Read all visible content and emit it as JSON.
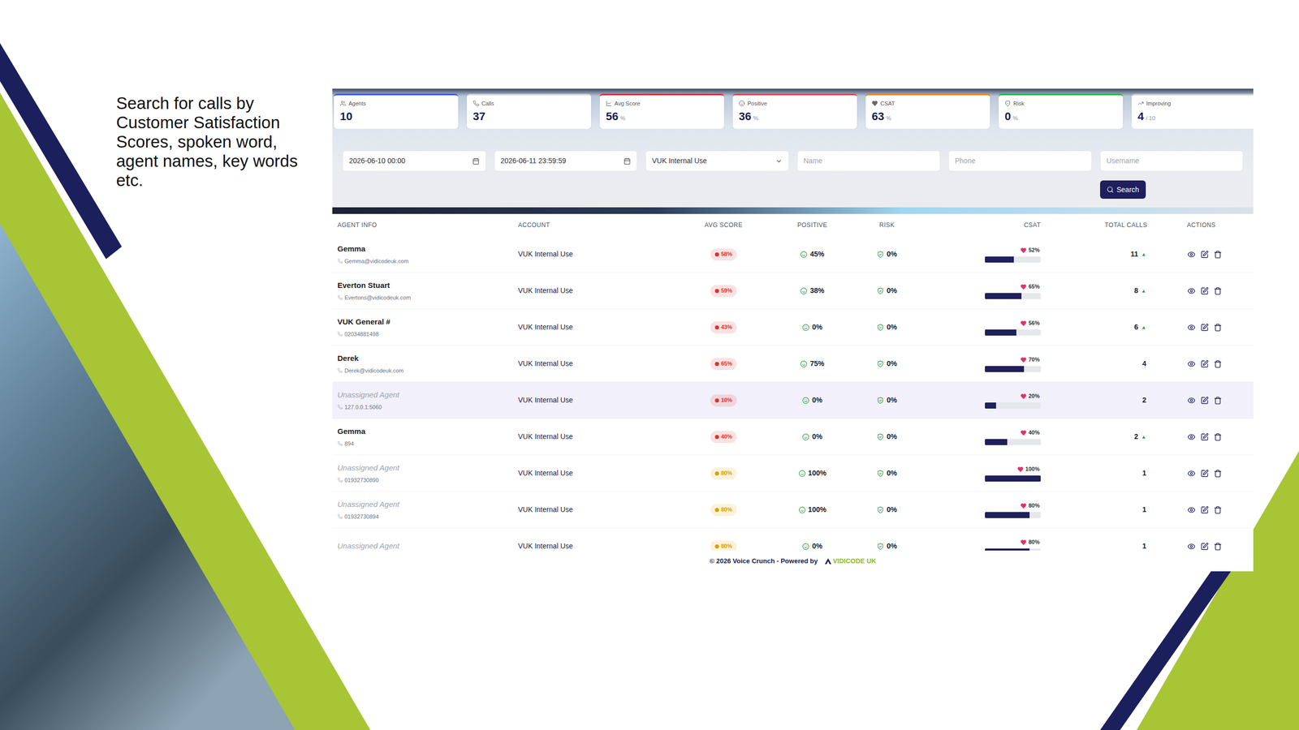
{
  "slide": {
    "heading_lines": [
      "Search for calls by",
      "Customer Satisfaction",
      "Scores, spoken word,",
      "agent names, key words",
      "etc."
    ]
  },
  "stats": [
    {
      "label": "Agents",
      "value": "10",
      "color": "#3b5bdb"
    },
    {
      "label": "Calls",
      "value": "37",
      "color": "#d0d4dc"
    },
    {
      "label": "Avg Score",
      "value": "56",
      "unit": "%",
      "color": "#e03131"
    },
    {
      "label": "Positive",
      "value": "36",
      "unit": "%",
      "color": "#e5484d"
    },
    {
      "label": "CSAT",
      "value": "63",
      "unit": "%",
      "color": "#f08c00"
    },
    {
      "label": "Risk",
      "value": "0",
      "unit": "%",
      "color": "#2fb344"
    },
    {
      "label": "Improving",
      "value": "4",
      "unit": "/ 10",
      "color": "#c9ccd3"
    }
  ],
  "filters": {
    "from": "2026-06-10 00:00",
    "to": "2026-06-11 23:59:59",
    "account": "VUK Internal Use",
    "name_placeholder": "Name",
    "phone_placeholder": "Phone",
    "username_placeholder": "Username"
  },
  "search_button": "Search",
  "table": {
    "columns": [
      "AGENT INFO",
      "ACCOUNT",
      "AVG SCORE",
      "POSITIVE",
      "RISK",
      "CSAT",
      "TOTAL CALLS",
      "ACTIONS"
    ],
    "rows": [
      {
        "agent": "Gemma",
        "contact": "Gemma@vidicodeuk.com",
        "assigned": true,
        "account": "VUK Internal Use",
        "avg_score": "58%",
        "score_color": "#e03131",
        "positive": "45%",
        "risk": "0%",
        "csat": "52%",
        "csat_level": 0.52,
        "total_calls": "11",
        "trend": "▲",
        "selected": false
      },
      {
        "agent": "Everton Stuart",
        "contact": "Evertons@vidicodeuk.com",
        "assigned": true,
        "account": "VUK Internal Use",
        "avg_score": "59%",
        "score_color": "#e03131",
        "positive": "38%",
        "risk": "0%",
        "csat": "65%",
        "csat_level": 0.65,
        "total_calls": "8",
        "trend": "▲",
        "selected": false
      },
      {
        "agent": "VUK General #",
        "contact": "02034881498",
        "assigned": true,
        "account": "VUK Internal Use",
        "avg_score": "43%",
        "score_color": "#e03131",
        "positive": "0%",
        "risk": "0%",
        "csat": "56%",
        "csat_level": 0.56,
        "total_calls": "6",
        "trend": "▲",
        "selected": false
      },
      {
        "agent": "Derek",
        "contact": "Derek@vidicodeuk.com",
        "assigned": true,
        "account": "VUK Internal Use",
        "avg_score": "65%",
        "score_color": "#e03131",
        "positive": "75%",
        "risk": "0%",
        "csat": "70%",
        "csat_level": 0.7,
        "total_calls": "4",
        "selected": false
      },
      {
        "agent": "Unassigned Agent",
        "contact": "127.0.0.1:5060",
        "assigned": false,
        "account": "VUK Internal Use",
        "avg_score": "10%",
        "score_color": "#e03131",
        "positive": "0%",
        "risk": "0%",
        "csat": "20%",
        "csat_level": 0.2,
        "total_calls": "2",
        "selected": true
      },
      {
        "agent": "Gemma",
        "contact": "894",
        "assigned": true,
        "account": "VUK Internal Use",
        "avg_score": "40%",
        "score_color": "#e03131",
        "positive": "0%",
        "risk": "0%",
        "csat": "40%",
        "csat_level": 0.4,
        "total_calls": "2",
        "trend": "▲",
        "selected": false
      },
      {
        "agent": "Unassigned Agent",
        "contact": "01932730890",
        "assigned": false,
        "account": "VUK Internal Use",
        "avg_score": "80%",
        "score_color": "#d9a000",
        "positive": "100%",
        "risk": "0%",
        "csat": "100%",
        "csat_level": 1.0,
        "total_calls": "1",
        "selected": false
      },
      {
        "agent": "Unassigned Agent",
        "contact": "01932730894",
        "assigned": false,
        "account": "VUK Internal Use",
        "avg_score": "80%",
        "score_color": "#d9a000",
        "positive": "100%",
        "risk": "0%",
        "csat": "80%",
        "csat_level": 0.8,
        "total_calls": "1",
        "selected": false
      },
      {
        "agent": "Unassigned Agent",
        "assigned": false,
        "account": "VUK Internal Use",
        "avg_score": "80%",
        "score_color": "#d9a000",
        "positive": "0%",
        "risk": "0%",
        "csat": "80%",
        "csat_level": 0.8,
        "total_calls": "1",
        "selected": false
      }
    ]
  },
  "footer": {
    "text": "© 2026 Voice Crunch - Powered by",
    "logo": "VIDICODE UK"
  }
}
